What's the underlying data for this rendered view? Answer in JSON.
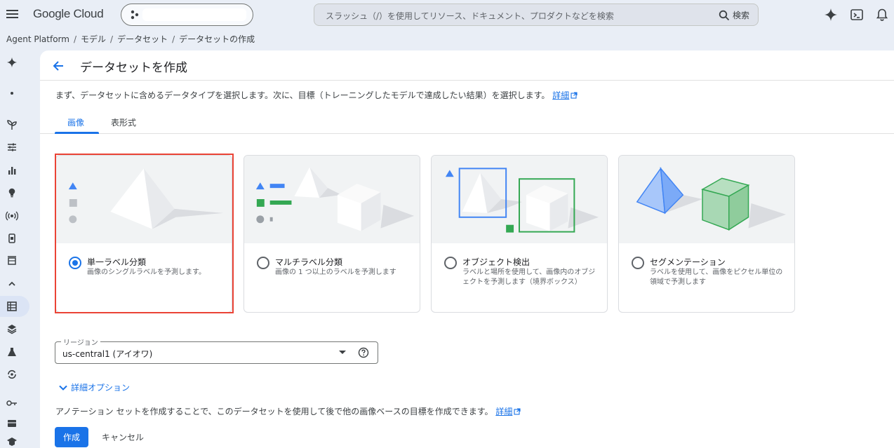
{
  "topbar": {
    "logo": "Google Cloud",
    "search_placeholder": "スラッシュ（/）を使用してリソース、ドキュメント、プロダクトなどを検索",
    "search_button": "検索",
    "icons": [
      "menu-icon",
      "gemini-icon",
      "cloud-shell-icon",
      "notifications-icon"
    ]
  },
  "breadcrumb": [
    "Agent Platform",
    "モデル",
    "データセット",
    "データセットの作成"
  ],
  "page": {
    "title": "データセットを作成",
    "description": "まず、データセットに含めるデータタイプを選択します。次に、目標（トレーニングしたモデルで達成したい結果）を選択します。",
    "learn_more": "詳細"
  },
  "tabs": [
    {
      "label": "画像",
      "active": true
    },
    {
      "label": "表形式",
      "active": false
    }
  ],
  "cards": [
    {
      "title": "単一ラベル分類",
      "desc": "画像のシングルラベルを予測します。",
      "selected": true
    },
    {
      "title": "マルチラベル分類",
      "desc": "画像の 1 つ以上のラベルを予測します",
      "selected": false
    },
    {
      "title": "オブジェクト検出",
      "desc": "ラベルと場所を使用して、画像内のオブジェクトを予測します（境界ボックス）",
      "selected": false
    },
    {
      "title": "セグメンテーション",
      "desc": "ラベルを使用して、画像をピクセル単位の領域で予測します",
      "selected": false
    }
  ],
  "region": {
    "label": "リージョン",
    "value": "us-central1 (アイオワ)"
  },
  "advanced_options": "詳細オプション",
  "annotation_note": "アノテーション セットを作成することで、このデータセットを使用して後で他の画像ベースの目標を作成できます。",
  "annotation_learn_more": "詳細",
  "buttons": {
    "create": "作成",
    "cancel": "キャンセル"
  },
  "colors": {
    "accent": "#1a73e8",
    "highlight": "#ea4335",
    "green": "#34a853"
  }
}
